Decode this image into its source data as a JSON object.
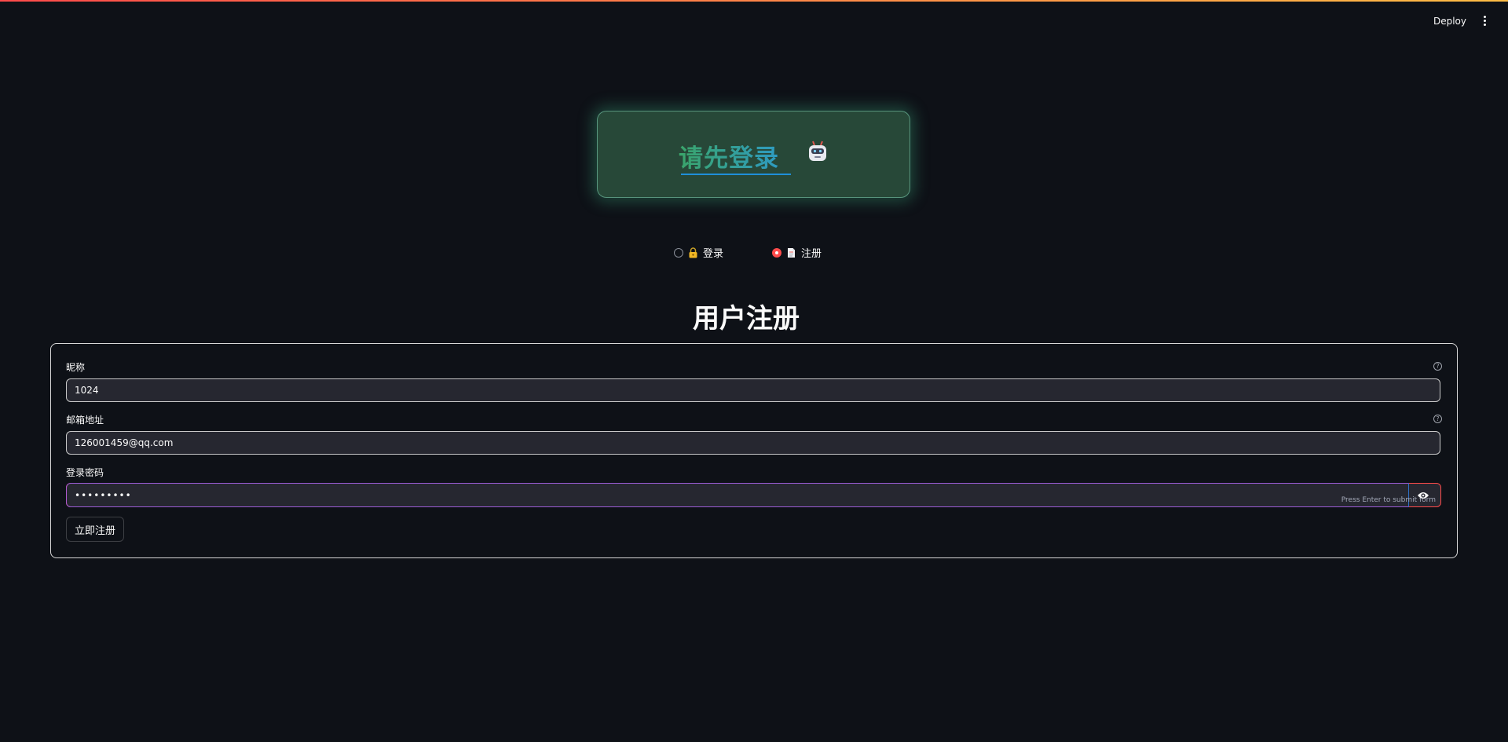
{
  "toolbar": {
    "deploy_label": "Deploy",
    "menu_icon": "kebab-menu-icon"
  },
  "banner": {
    "title": "请先登录",
    "icon": "robot-icon",
    "gradient": [
      "#3aa56a",
      "#2e9bc2"
    ]
  },
  "auth_mode": {
    "options": [
      {
        "label": "登录",
        "icon": "lock-icon",
        "selected": false
      },
      {
        "label": "注册",
        "icon": "document-icon",
        "selected": true
      }
    ]
  },
  "page_title": "用户注册",
  "form": {
    "nickname": {
      "label": "昵称",
      "value": "1024"
    },
    "email": {
      "label": "邮箱地址",
      "value": "126001459@qq.com"
    },
    "password": {
      "label": "登录密码",
      "value": "•••••••••",
      "hint": "Press Enter to submit form"
    },
    "submit_label": "立即注册"
  },
  "colors": {
    "background": "#0e1117",
    "accent": "#ff4b4b",
    "input_bg": "#262730"
  }
}
